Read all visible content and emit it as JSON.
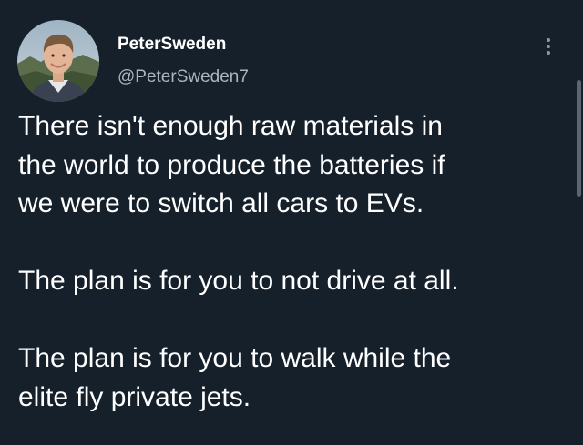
{
  "tweet": {
    "author": {
      "display_name": "PeterSweden",
      "handle": "@PeterSweden7",
      "avatar": "profile-photo"
    },
    "more_icon": "more-options-icon",
    "paragraphs": [
      "There isn't enough raw materials in\nthe world to produce the batteries if\nwe were to switch all cars to EVs.",
      "The plan is for you to not drive at all.",
      "The plan is for you to walk while the\nelite fly private jets."
    ]
  },
  "colors": {
    "background": "#15202b",
    "text_primary": "#ffffff",
    "text_secondary": "#a9b6c2",
    "icon": "#8b98a5"
  }
}
